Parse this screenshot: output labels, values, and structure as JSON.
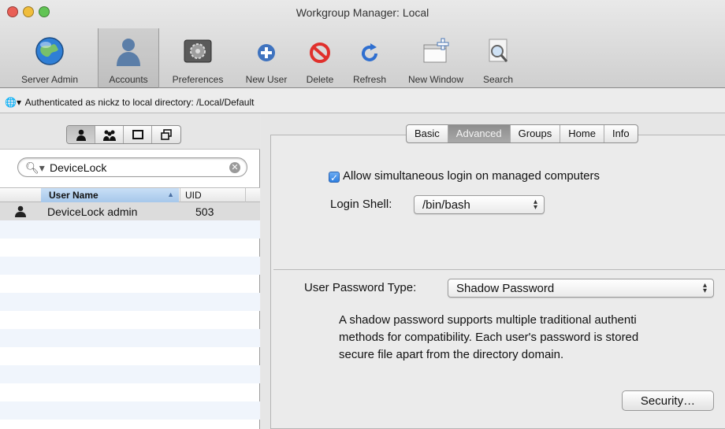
{
  "window": {
    "title": "Workgroup Manager: Local"
  },
  "toolbar": {
    "server_admin": "Server Admin",
    "accounts": "Accounts",
    "preferences": "Preferences",
    "new_user": "New User",
    "delete": "Delete",
    "refresh": "Refresh",
    "new_window": "New Window",
    "search": "Search"
  },
  "auth": {
    "text": "Authenticated as nickz to local directory: /Local/Default"
  },
  "search": {
    "value": "DeviceLock"
  },
  "table": {
    "col_user_name": "User Name",
    "col_uid": "UID",
    "rows": [
      {
        "name": "DeviceLock admin",
        "uid": "503"
      }
    ]
  },
  "tabs": [
    "Basic",
    "Advanced",
    "Groups",
    "Home",
    "Info"
  ],
  "advanced": {
    "allow_login": "Allow simultaneous login on managed computers",
    "login_shell_label": "Login Shell:",
    "login_shell_value": "/bin/bash",
    "pw_type_label": "User Password Type:",
    "pw_type_value": "Shadow Password",
    "desc_line1": "A shadow password supports multiple traditional authenti",
    "desc_line2": "methods for compatibility. Each user's password is stored",
    "desc_line3": "secure file apart from the directory domain.",
    "security_button": "Security…"
  },
  "colors": {
    "close": "#e95f56",
    "minimize": "#f0bd3b",
    "zoom": "#61c454",
    "accent": "#3b86e5"
  }
}
